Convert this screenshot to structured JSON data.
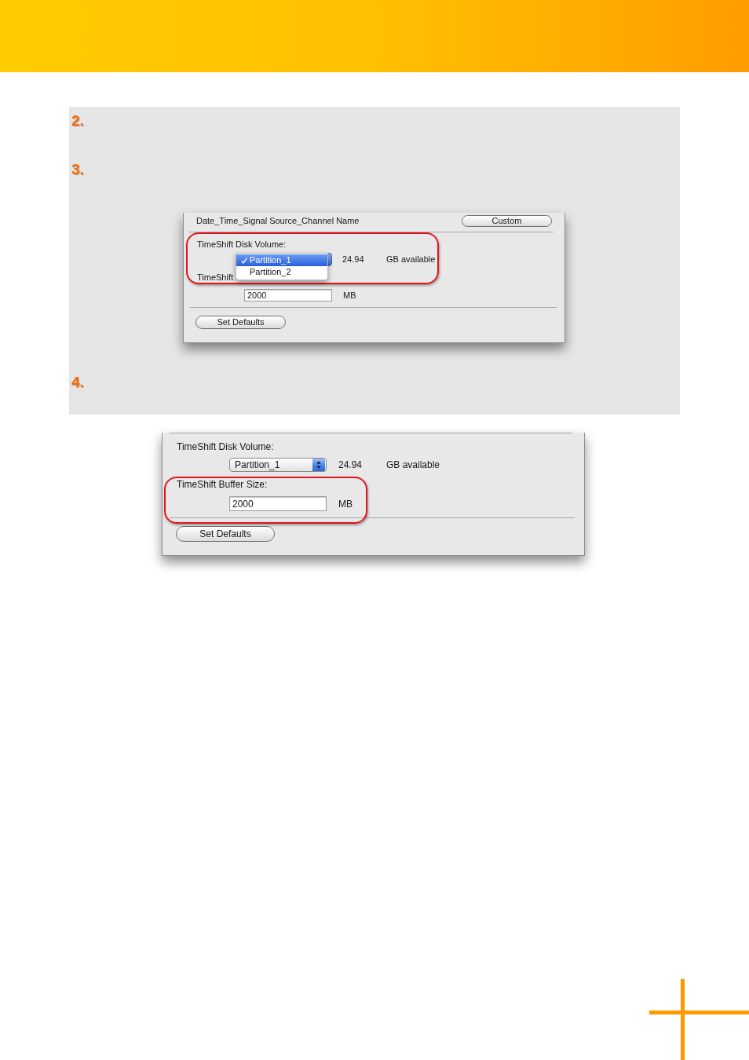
{
  "instructions": {
    "steps": [
      {
        "label": "2."
      },
      {
        "label": "3.",
        "screenshot": {
          "top_row": {
            "text": "Date_Time_Signal Source_Channel Name",
            "button": "Custom"
          },
          "disk_volume": {
            "label": "TimeShift Disk Volume:",
            "highlighted": true,
            "popup": {
              "expanded": true,
              "options": [
                {
                  "label": "Partition_1",
                  "selected": true
                },
                {
                  "label": "Partition_2",
                  "selected": false
                }
              ]
            },
            "amount": "24.94",
            "unit": "GB available"
          },
          "buffer_size": {
            "label": "TimeShift",
            "value": "2000",
            "unit": "MB"
          },
          "buttons": [
            "Set Defaults"
          ]
        }
      },
      {
        "label": "4."
      }
    ]
  },
  "result_screenshot": {
    "disk_volume": {
      "label": "TimeShift Disk Volume:",
      "popup": {
        "value": "Partition_1",
        "expanded": false
      },
      "amount": "24.94",
      "unit": "GB available"
    },
    "buffer_size": {
      "label": "TimeShift Buffer Size:",
      "highlighted": true,
      "value": "2000",
      "unit": "MB"
    },
    "buttons": [
      "Set Defaults"
    ]
  }
}
